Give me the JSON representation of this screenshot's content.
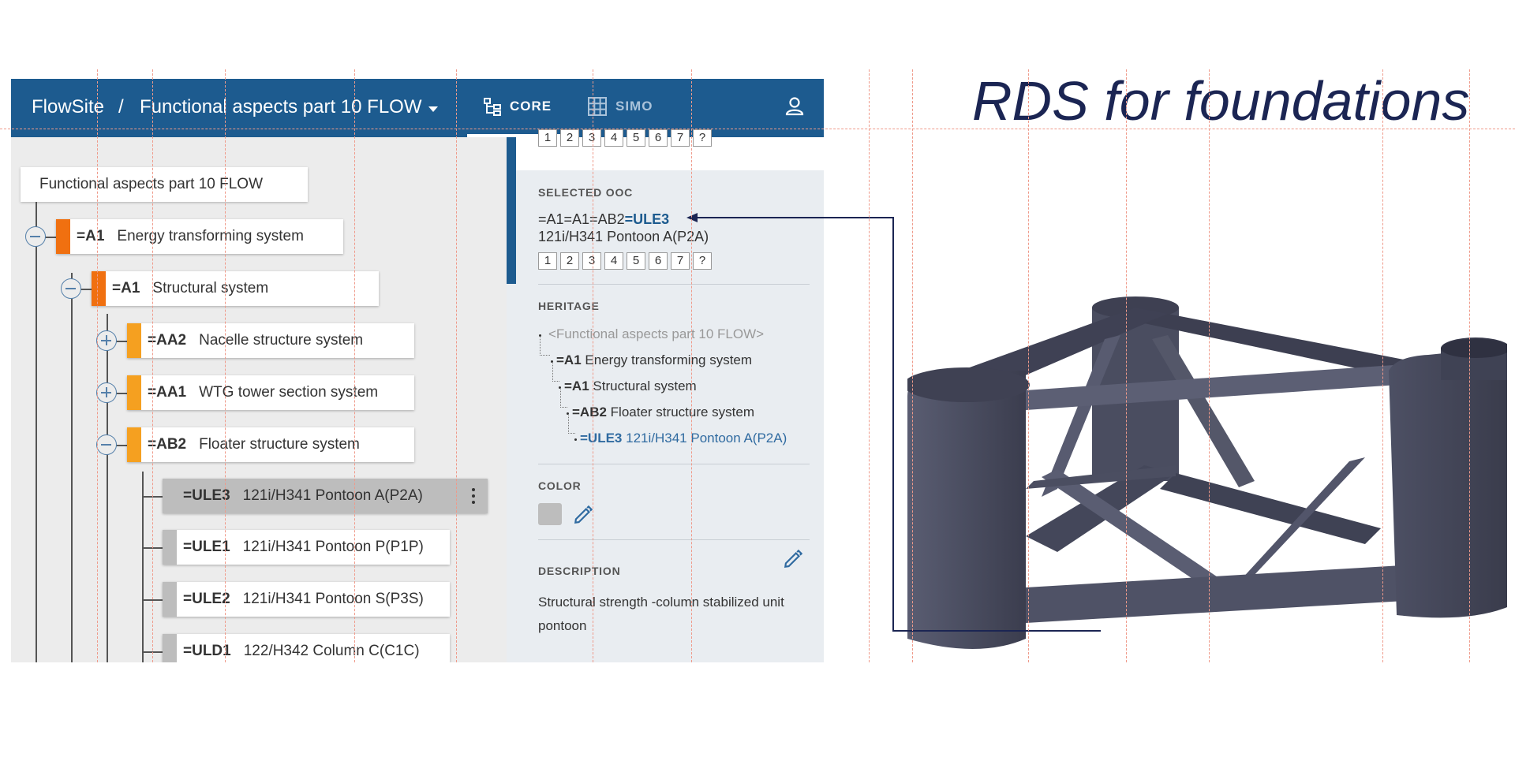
{
  "header": {
    "brand": "FlowSite",
    "separator": "/",
    "project": "Functional aspects part 10 FLOW",
    "tabs": [
      {
        "label": "CORE",
        "icon": "tree-structure-icon",
        "active": true
      },
      {
        "label": "SIMO",
        "icon": "grid-table-icon",
        "active": false
      }
    ],
    "user_icon": "user-icon",
    "accent_color": "#1d5b8f"
  },
  "tree": {
    "root": "Functional aspects part 10 FLOW",
    "nodes": [
      {
        "code": "=A1",
        "label": "Energy transforming system",
        "color": "#f07010",
        "toggle": "minus"
      },
      {
        "code": "=A1",
        "label": "Structural system",
        "color": "#f07010",
        "toggle": "minus"
      },
      {
        "code": "=AA2",
        "label": "Nacelle structure system",
        "color": "#f5a020",
        "toggle": "plus"
      },
      {
        "code": "=AA1",
        "label": "WTG tower section system",
        "color": "#f5a020",
        "toggle": "plus"
      },
      {
        "code": "=AB2",
        "label": "Floater structure system",
        "color": "#f5a020",
        "toggle": "minus"
      },
      {
        "code": "=ULE3",
        "label": "121i/H341 Pontoon A(P2A)",
        "color": "#bdbdbd",
        "selected": true
      },
      {
        "code": "=ULE1",
        "label": "121i/H341 Pontoon P(P1P)",
        "color": "#bdbdbd"
      },
      {
        "code": "=ULE2",
        "label": "121i/H341 Pontoon S(P3S)",
        "color": "#bdbdbd"
      },
      {
        "code": "=ULD1",
        "label": "122/H342 Column C(C1C)",
        "color": "#bdbdbd"
      }
    ]
  },
  "detail": {
    "steps": [
      "1",
      "2",
      "3",
      "4",
      "5",
      "6",
      "7",
      "?"
    ],
    "selected_label": "SELECTED OOC",
    "selected_path_prefix": "=A1=A1=AB2",
    "selected_path_code": "=ULE3",
    "selected_name": "121i/H341 Pontoon A(P2A)",
    "heritage_label": "HERITAGE",
    "heritage": [
      {
        "code": "",
        "text": "<Functional aspects part 10 FLOW>"
      },
      {
        "code": "=A1",
        "text": "Energy transforming system"
      },
      {
        "code": "=A1",
        "text": "Structural system"
      },
      {
        "code": "=AB2",
        "text": "Floater structure system"
      },
      {
        "code": "=ULE3",
        "text": "121i/H341 Pontoon A(P2A)"
      }
    ],
    "color_label": "COLOR",
    "color_swatch": "#bdbdbd",
    "description_label": "DESCRIPTION",
    "description_line1": "Structural strength -column stabilized unit",
    "description_line2": "pontoon"
  },
  "slide": {
    "title": "RDS for foundations",
    "title_color": "#1b2553",
    "model_color": "#4f5266"
  }
}
